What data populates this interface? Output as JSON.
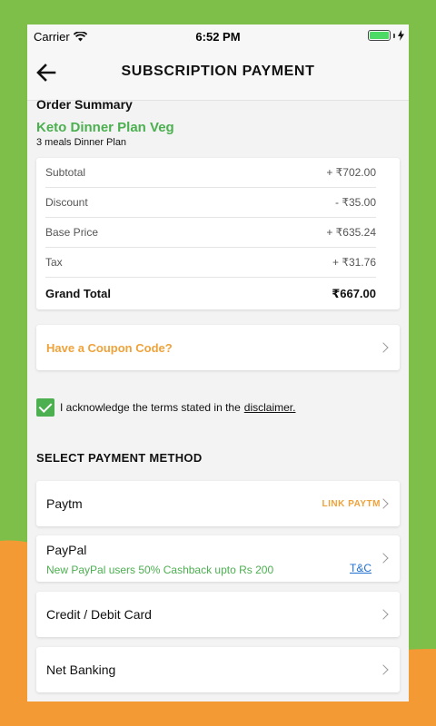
{
  "status_bar": {
    "carrier": "Carrier",
    "time": "6:52 PM"
  },
  "nav": {
    "title": "SUBSCRIPTION PAYMENT",
    "back_icon": "arrow-left-icon"
  },
  "order": {
    "section_title": "Order Summary",
    "plan_name": "Keto Dinner Plan Veg",
    "plan_desc": "3 meals Dinner Plan",
    "rows": [
      {
        "label": "Subtotal",
        "value": "+ ₹702.00"
      },
      {
        "label": "Discount",
        "value": "- ₹35.00"
      },
      {
        "label": "Base Price",
        "value": "+ ₹635.24"
      },
      {
        "label": "Tax",
        "value": "+ ₹31.76"
      }
    ],
    "total": {
      "label": "Grand Total",
      "value": "₹667.00"
    }
  },
  "coupon": {
    "label": "Have a Coupon Code?"
  },
  "acknowledge": {
    "text": "I acknowledge the terms stated in the",
    "link": "disclaimer.",
    "checked": true
  },
  "payment": {
    "section_title": "SELECT PAYMENT METHOD",
    "methods": [
      {
        "label": "Paytm",
        "action": "LINK PAYTM"
      },
      {
        "label": "PayPal",
        "promo": "New PayPal users 50% Cashback upto Rs 200",
        "tnc": "T&C"
      },
      {
        "label": "Credit / Debit Card"
      },
      {
        "label": "Net Banking"
      }
    ]
  },
  "colors": {
    "green": "#4caf50",
    "orange": "#f0a23a",
    "link_blue": "#1f6fd1",
    "bg_green": "#7ebf4a",
    "bg_orange": "#f39a35"
  }
}
